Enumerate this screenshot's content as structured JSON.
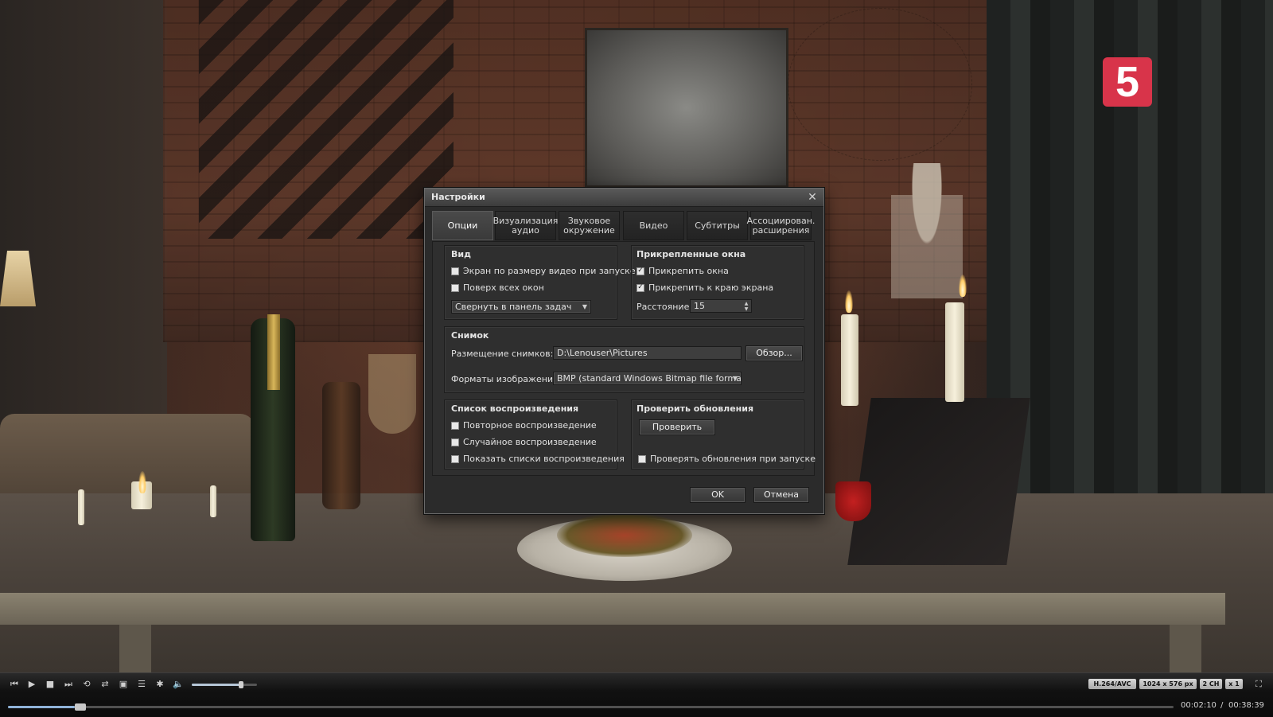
{
  "channel_logo": "5",
  "dialog": {
    "title": "Настройки",
    "tabs": [
      {
        "label": "Опции"
      },
      {
        "label": "Визуализация аудио"
      },
      {
        "label": "Звуковое окружение"
      },
      {
        "label": "Видео"
      },
      {
        "label": "Субтитры"
      },
      {
        "label": "Ассоциирован. расширения"
      }
    ],
    "active_tab": "Опции",
    "view_group": {
      "title": "Вид",
      "fit_to_video": {
        "label": "Экран по размеру видео при запуске",
        "checked": false
      },
      "always_on_top": {
        "label": "Поверх всех окон",
        "checked": false
      },
      "minimize_select": "Свернуть в панель задач"
    },
    "docked_group": {
      "title": "Прикрепленные окна",
      "dock_windows": {
        "label": "Прикрепить окна",
        "checked": true
      },
      "dock_edge": {
        "label": "Прикрепить к краю экрана",
        "checked": true
      },
      "distance_label": "Расстояние:",
      "distance_value": "15"
    },
    "snapshot_group": {
      "title": "Снимок",
      "location_label": "Размещение снимков:",
      "location_value": "D:\\Lenouser\\Pictures",
      "browse_label": "Обзор...",
      "format_label": "Форматы изображений:",
      "format_value": "BMP (standard Windows Bitmap file format)"
    },
    "playlist_group": {
      "title": "Список воспроизведения",
      "repeat": {
        "label": "Повторное воспроизведение",
        "checked": false
      },
      "shuffle": {
        "label": "Случайное воспроизведение",
        "checked": false
      },
      "show_playlists": {
        "label": "Показать списки воспроизведения",
        "checked": false
      }
    },
    "updates_group": {
      "title": "Проверить обновления",
      "check_button": "Проверить",
      "check_on_start": {
        "label": "Проверять обновления при запуске",
        "checked": false
      }
    },
    "ok_label": "OK",
    "cancel_label": "Отмена"
  },
  "player": {
    "icons": [
      "prev-icon",
      "play-icon",
      "stop-icon",
      "next-icon",
      "repeat-icon",
      "shuffle-icon",
      "snapshot-icon",
      "playlist-icon",
      "settings-icon",
      "volume-icon"
    ],
    "volume_level": 0.75,
    "badges": {
      "codec": "H.264/AVC",
      "resolution": "1024 x 576 px",
      "channels": "2 CH",
      "speed": "x 1"
    },
    "progress_fraction": 0.057,
    "time_current": "00:02:10",
    "time_separator": "/",
    "time_total": "00:38:39"
  }
}
